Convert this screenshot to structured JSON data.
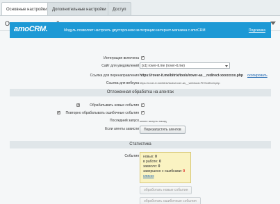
{
  "tabs": [
    {
      "label": "Основные настройки",
      "active": true
    },
    {
      "label": "Дополнительные настройки",
      "active": false
    },
    {
      "label": "Доступ",
      "active": false
    }
  ],
  "panel": {
    "title": "Основные настройки"
  },
  "banner": {
    "logo": "amoCRM.",
    "text": "Модуль позволяет настроить двустороннюю интеграцию интернет-магазина с amoCRM",
    "help_link": "Подсказка",
    "color": "#1d99d5"
  },
  "settings": {
    "integration_label": "Интеграция включена",
    "site_label": "Сайт для уведомлений",
    "site_value": "[s1] rover-it.me (rover-it.me)",
    "redirect_label": "Ссылка для перенаправления",
    "redirect_value": "https://rover-it.me/bitrix/tools/rover-as__redirect-xxxxxxxx.php",
    "copy_link": "скопировать",
    "webhook_label": "Ссылка для вебхука",
    "webhook_value": "https://rover-it.me/bitrix/tools/rover-as__webhook.PHSx4f1d4.php"
  },
  "agents": {
    "section_title": "Отложенная обработка на агентах",
    "process_new_label": "Обрабатывать новые события",
    "retry_errors_label": "Повторно обрабатывать ошибочные события",
    "last_run_label": "Последний запуск",
    "last_run_value": "менее минуты назад",
    "stuck_label": "Если агенты зависли",
    "restart_button": "Перезапустить агентов"
  },
  "stats": {
    "section_title": "Статистика",
    "events_label": "События",
    "new_label": "новых:",
    "new_value": "0",
    "in_work_label": "в работе:",
    "in_work_value": "0",
    "hung_label": "зависло:",
    "hung_value": "0",
    "errors_label": "завершено с ошибками:",
    "errors_value": "0",
    "list_link": "список",
    "process_new_button": "обработать новые события",
    "process_errors_button": "обработать ошибочные события"
  }
}
